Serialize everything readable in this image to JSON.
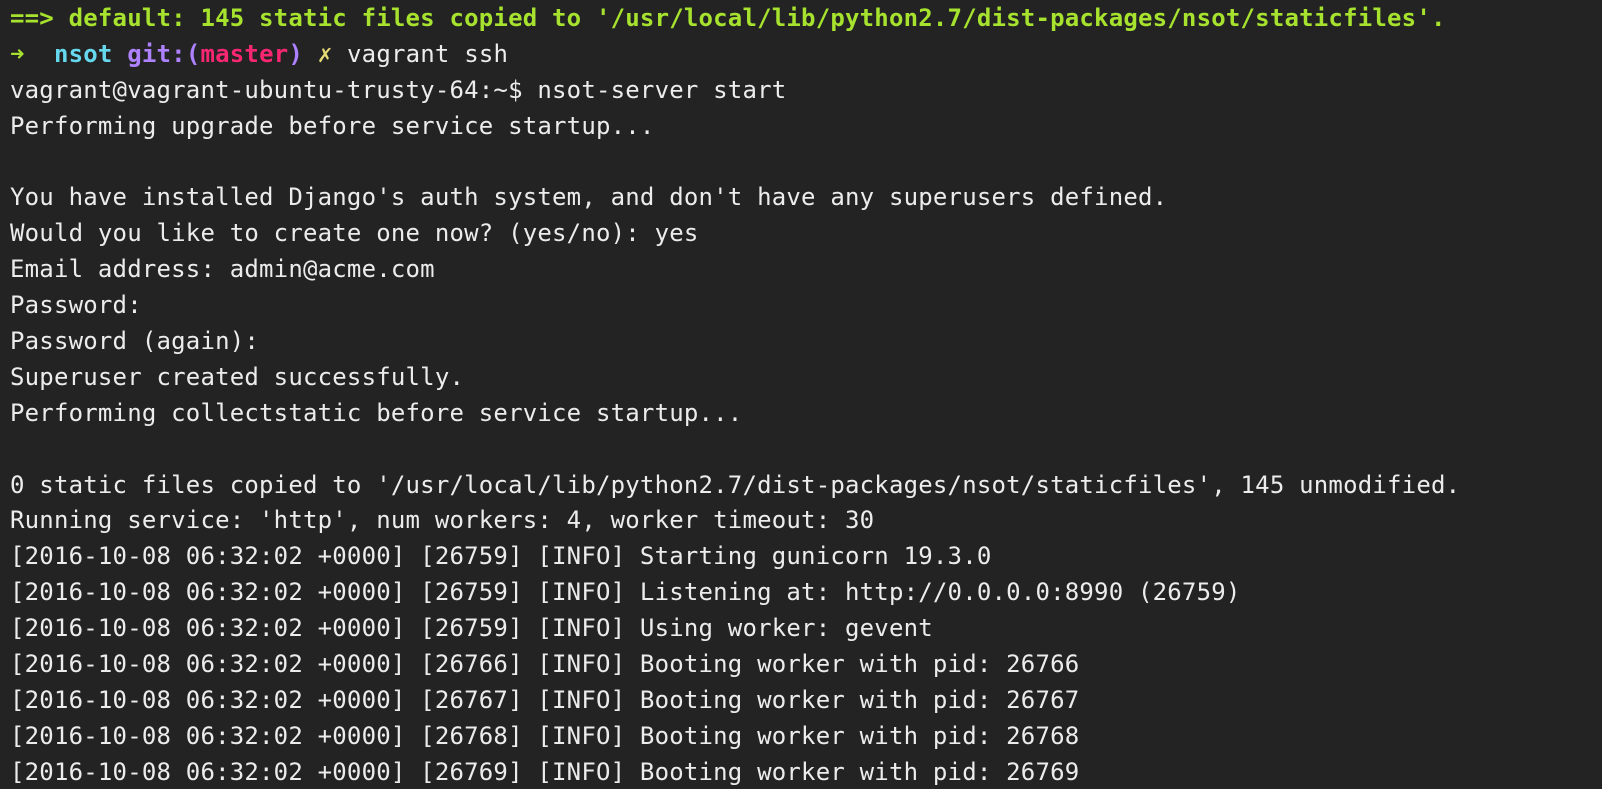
{
  "terminal": {
    "vagrant_output": "==> default: 145 static files copied to '/usr/local/lib/python2.7/dist-packages/nsot/staticfiles'.",
    "prompt": {
      "arrow": "➜",
      "dir": "nsot",
      "git_prefix": "git:(",
      "branch": "master",
      "git_suffix": ")",
      "dirty_mark": "✗",
      "command": "vagrant ssh"
    },
    "shell_prompt": "vagrant@vagrant-ubuntu-trusty-64:~$ nsot-server start",
    "output": [
      "Performing upgrade before service startup...",
      "",
      "You have installed Django's auth system, and don't have any superusers defined.",
      "Would you like to create one now? (yes/no): yes",
      "Email address: admin@acme.com",
      "Password: ",
      "Password (again): ",
      "Superuser created successfully.",
      "Performing collectstatic before service startup...",
      "",
      "0 static files copied to '/usr/local/lib/python2.7/dist-packages/nsot/staticfiles', 145 unmodified.",
      "Running service: 'http', num workers: 4, worker timeout: 30",
      "[2016-10-08 06:32:02 +0000] [26759] [INFO] Starting gunicorn 19.3.0",
      "[2016-10-08 06:32:02 +0000] [26759] [INFO] Listening at: http://0.0.0.0:8990 (26759)",
      "[2016-10-08 06:32:02 +0000] [26759] [INFO] Using worker: gevent",
      "[2016-10-08 06:32:02 +0000] [26766] [INFO] Booting worker with pid: 26766",
      "[2016-10-08 06:32:02 +0000] [26767] [INFO] Booting worker with pid: 26767",
      "[2016-10-08 06:32:02 +0000] [26768] [INFO] Booting worker with pid: 26768",
      "[2016-10-08 06:32:02 +0000] [26769] [INFO] Booting worker with pid: 26769"
    ]
  },
  "colors": {
    "background": "#232323",
    "text": "#ececec",
    "vagrant_green": "#a6e22e",
    "dir_cyan": "#66d9ef",
    "git_purple": "#ae81ff",
    "branch_pink": "#f92672",
    "dirty_yellow": "#e6db74"
  }
}
